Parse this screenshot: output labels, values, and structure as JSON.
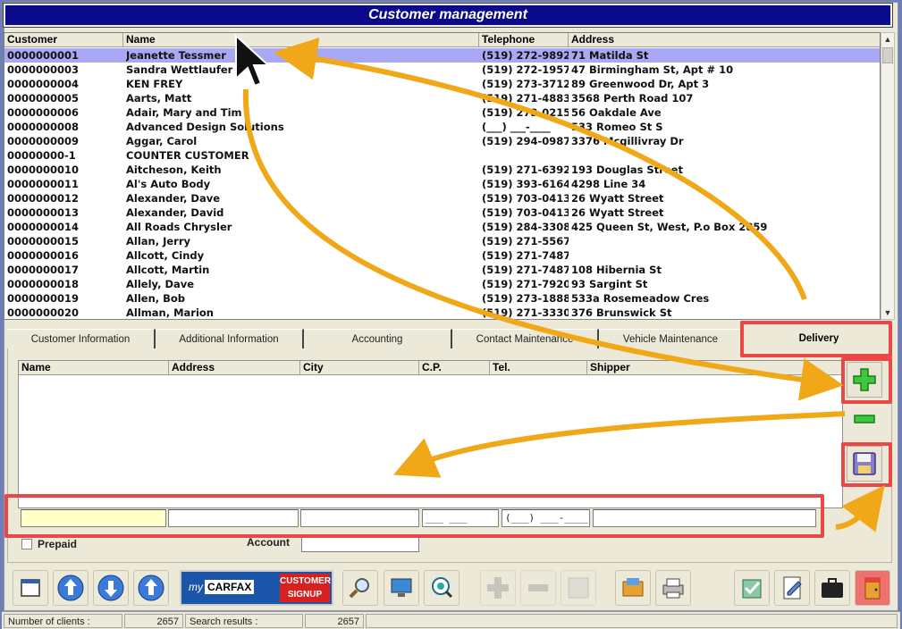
{
  "window": {
    "title": "Customer management"
  },
  "customers": {
    "columns": [
      "Customer",
      "Name",
      "Telephone",
      "Address"
    ],
    "rows": [
      [
        "0000000001",
        "Jeanette Tessmer",
        "(519) 272-9892",
        "71 Matilda St"
      ],
      [
        "0000000003",
        "Sandra Wettlaufer",
        "(519) 272-1957",
        "47 Birmingham St, Apt # 10"
      ],
      [
        "0000000004",
        " KEN FREY",
        "(519) 273-3712",
        "89 Greenwood Dr, Apt 3"
      ],
      [
        "0000000005",
        "Aarts, Matt",
        "(519) 271-4883",
        "3568 Perth Road 107"
      ],
      [
        "0000000006",
        "Adair, Mary and Tim",
        "(519) 273-0215",
        "56 Oakdale Ave"
      ],
      [
        "0000000008",
        "Advanced Design Solutions",
        "(___) ___-____",
        "533 Romeo St S"
      ],
      [
        "0000000009",
        "Aggar, Carol",
        "(519) 294-0987",
        "3376 Mcgillivray Dr"
      ],
      [
        "00000000-1",
        "COUNTER CUSTOMER",
        "",
        ""
      ],
      [
        "0000000010",
        "Aitcheson, Keith",
        "(519) 271-6392",
        "193 Douglas Street"
      ],
      [
        "0000000011",
        "Al's Auto Body",
        "(519) 393-6164",
        "4298 Line 34"
      ],
      [
        "0000000012",
        "Alexander, Dave",
        "(519) 703-0413",
        "26 Wyatt Street"
      ],
      [
        "0000000013",
        "Alexander, David",
        "(519) 703-0413",
        "26 Wyatt Street"
      ],
      [
        "0000000014",
        "All Roads Chrysler",
        "(519) 284-3308",
        "425 Queen St, West, P.o Box 2859"
      ],
      [
        "0000000015",
        "Allan, Jerry",
        "(519) 271-5567",
        ""
      ],
      [
        "0000000016",
        "Allcott, Cindy",
        "(519) 271-7487",
        ""
      ],
      [
        "0000000017",
        "Allcott, Martin",
        "(519) 271-7487",
        "108 Hibernia St"
      ],
      [
        "0000000018",
        "Allely, Dave",
        "(519) 271-7920",
        "93 Sargint St"
      ],
      [
        "0000000019",
        "Allen, Bob",
        "(519) 273-1888",
        "533a Rosemeadow Cres"
      ],
      [
        "0000000020",
        "Allman, Marion",
        "(519) 271-3330",
        "376 Brunswick St"
      ]
    ]
  },
  "tabs": [
    "Customer Information",
    "Additional Information",
    "Accounting",
    "Contact Maintenance",
    "Vehicle Maintenance",
    "Delivery"
  ],
  "delivery": {
    "columns": [
      "Name",
      "Address",
      "City",
      "C.P.",
      "Tel.",
      "Shipper"
    ],
    "inputs": {
      "cp_mask": "___ ___",
      "tel_mask": "(___) ___-____"
    }
  },
  "form": {
    "prepaid_label": "Prepaid",
    "account_label": "Account"
  },
  "carfax": {
    "brand_prefix": "my",
    "brand": "CARFAX",
    "signup_line1": "CUSTOMER",
    "signup_line2": "SIGNUP"
  },
  "status": {
    "clients_label": "Number of clients :",
    "clients_value": "2657",
    "results_label": "Search results :",
    "results_value": "2657"
  },
  "colors": {
    "title_bg": "#0a0a8a",
    "selection": "#a8a8f4",
    "highlight": "#ea4747",
    "arrow": "#f0a818"
  }
}
